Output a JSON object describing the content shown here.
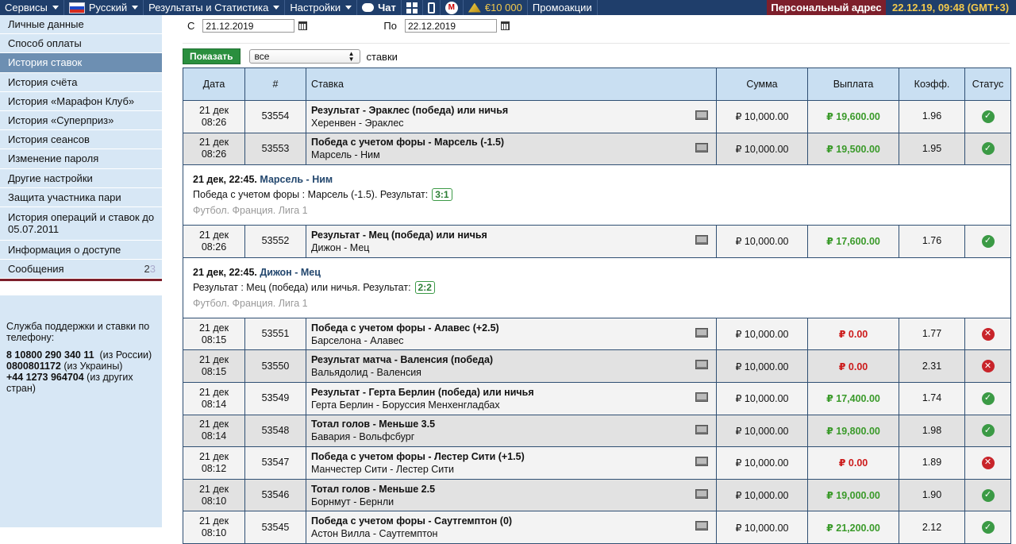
{
  "topbar": {
    "services": "Сервисы",
    "language": "Русский",
    "results": "Результаты и Статистика",
    "settings": "Настройки",
    "chat": "Чат",
    "balance": "€10 000",
    "promo": "Промоакции",
    "personal": "Персональный адрес",
    "datetime": "22.12.19, 09:48 (GMT+3)"
  },
  "sidebar": {
    "items": [
      {
        "label": "Личные данные"
      },
      {
        "label": "Способ оплаты"
      },
      {
        "label": "История ставок"
      },
      {
        "label": "История счёта"
      },
      {
        "label": "История «Марафон Клуб»"
      },
      {
        "label": "История «Суперприз»"
      },
      {
        "label": "История сеансов"
      },
      {
        "label": "Изменение пароля"
      },
      {
        "label": "Другие настройки"
      },
      {
        "label": "Защита участника пари"
      },
      {
        "label": "История операций и ставок до 05.07.2011"
      },
      {
        "label": "Информация о доступе"
      },
      {
        "label": "Сообщения",
        "count": "2",
        "count_muted": "3"
      }
    ],
    "support": {
      "title": "Служба поддержки и ставки по телефону:",
      "phone1": "8 10800 290 340 11",
      "phone1_note": "(из России)",
      "phone2": "0800801172",
      "phone2_note": "(из Украины)",
      "phone3": "+44 1273 964704",
      "phone3_note": "(из других стран)"
    }
  },
  "filters": {
    "from_label": "С",
    "from_value": "21.12.2019",
    "to_label": "По",
    "to_value": "22.12.2019",
    "show_button": "Показать",
    "select_value": "все",
    "stakes_word": "ставки"
  },
  "table": {
    "headers": [
      "Дата",
      "#",
      "Ставка",
      "Сумма",
      "Выплата",
      "Коэфф.",
      "Статус"
    ],
    "rows": [
      {
        "day": "21 дек",
        "time": "08:26",
        "id": "53554",
        "title": "Результат - Эраклес (победа) или ничья",
        "match": "Херенвен - Эраклес",
        "amount": "₽ 10,000.00",
        "payout": "₽ 19,600.00",
        "coef": "1.96",
        "status": "win"
      },
      {
        "day": "21 дек",
        "time": "08:26",
        "id": "53553",
        "title": "Победа с учетом форы - Марсель (-1.5)",
        "match": "Марсель - Ним",
        "amount": "₽ 10,000.00",
        "payout": "₽ 19,500.00",
        "coef": "1.95",
        "status": "win",
        "detail": {
          "head": "21 дек, 22:45.",
          "match": "Марсель - Ним",
          "line": "Победа с учетом форы : Марсель (-1.5). Результат:",
          "score": "3:1",
          "league": "Футбол. Франция. Лига 1"
        }
      },
      {
        "day": "21 дек",
        "time": "08:26",
        "id": "53552",
        "title": "Результат - Мец (победа) или ничья",
        "match": "Дижон - Мец",
        "amount": "₽ 10,000.00",
        "payout": "₽ 17,600.00",
        "coef": "1.76",
        "status": "win",
        "detail": {
          "head": "21 дек, 22:45.",
          "match": "Дижон - Мец",
          "line": "Результат : Мец (победа) или ничья. Результат:",
          "score": "2:2",
          "league": "Футбол. Франция. Лига 1"
        }
      },
      {
        "day": "21 дек",
        "time": "08:15",
        "id": "53551",
        "title": "Победа с учетом форы - Алавес (+2.5)",
        "match": "Барселона - Алавес",
        "amount": "₽ 10,000.00",
        "payout": "₽ 0.00",
        "coef": "1.77",
        "status": "lose"
      },
      {
        "day": "21 дек",
        "time": "08:15",
        "id": "53550",
        "title": "Результат матча - Валенсия (победа)",
        "match": "Вальядолид - Валенсия",
        "amount": "₽ 10,000.00",
        "payout": "₽ 0.00",
        "coef": "2.31",
        "status": "lose"
      },
      {
        "day": "21 дек",
        "time": "08:14",
        "id": "53549",
        "title": "Результат - Герта Берлин (победа) или ничья",
        "match": "Герта Берлин - Боруссия Менхенгладбах",
        "amount": "₽ 10,000.00",
        "payout": "₽ 17,400.00",
        "coef": "1.74",
        "status": "win"
      },
      {
        "day": "21 дек",
        "time": "08:14",
        "id": "53548",
        "title": "Тотал голов - Меньше 3.5",
        "match": "Бавария - Вольфсбург",
        "amount": "₽ 10,000.00",
        "payout": "₽ 19,800.00",
        "coef": "1.98",
        "status": "win"
      },
      {
        "day": "21 дек",
        "time": "08:12",
        "id": "53547",
        "title": "Победа с учетом форы - Лестер Сити (+1.5)",
        "match": "Манчестер Сити - Лестер Сити",
        "amount": "₽ 10,000.00",
        "payout": "₽ 0.00",
        "coef": "1.89",
        "status": "lose"
      },
      {
        "day": "21 дек",
        "time": "08:10",
        "id": "53546",
        "title": "Тотал голов - Меньше 2.5",
        "match": "Борнмут - Бернли",
        "amount": "₽ 10,000.00",
        "payout": "₽ 19,000.00",
        "coef": "1.90",
        "status": "win"
      },
      {
        "day": "21 дек",
        "time": "08:10",
        "id": "53545",
        "title": "Победа с учетом форы - Саутгемптон (0)",
        "match": "Астон Вилла - Саутгемптон",
        "amount": "₽ 10,000.00",
        "payout": "₽ 21,200.00",
        "coef": "2.12",
        "status": "win"
      }
    ]
  },
  "colors": {
    "win": "#3b9a45",
    "lose": "#c8242a",
    "header_bg": "#1f3e6b",
    "personal_bg": "#7d1f2b"
  }
}
